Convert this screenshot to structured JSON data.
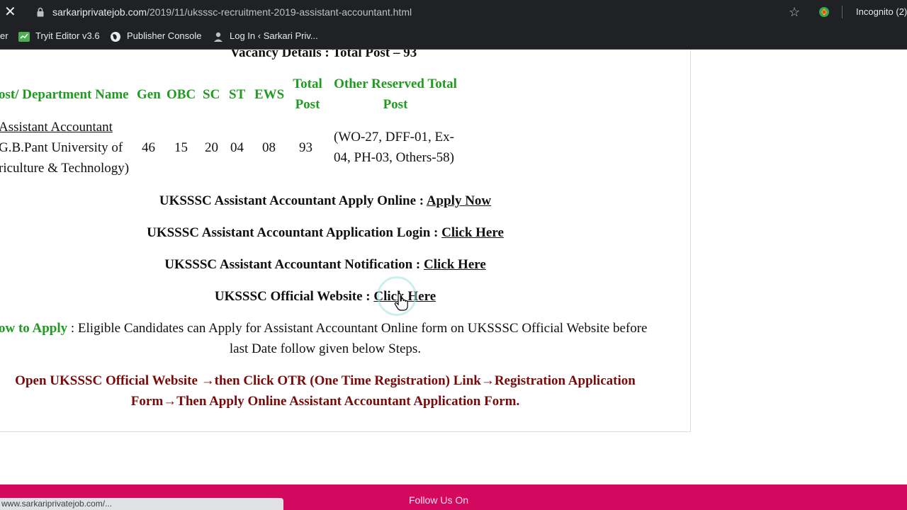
{
  "browser": {
    "url_host": "sarkariprivatejob.com",
    "url_path": "/2019/11/uksssc-recruitment-2019-assistant-accountant.html",
    "incognito_label": "Incognito (2)",
    "icons": [
      "close-icon",
      "lock-icon",
      "star-icon",
      "extension-icon"
    ]
  },
  "bookmarks": [
    {
      "label": "er"
    },
    {
      "label": "Tryit Editor v3.6"
    },
    {
      "label": "Publisher Console"
    },
    {
      "label": "Log In ‹ Sarkari Priv..."
    }
  ],
  "vacancy": {
    "heading": "Vacancy Details : Total Post – 93",
    "headers": {
      "dept": "ost/ Department Name",
      "gen": "Gen",
      "obc": "OBC",
      "sc": "SC",
      "st": "ST",
      "ews": "EWS",
      "total_line1": "Total",
      "total_line2": "Post",
      "other_line1": "Other Reserved Total",
      "other_line2": "Post"
    },
    "row": {
      "dept_line1": "Assistant Accountant",
      "dept_line2": "G.B.Pant University of",
      "dept_line3": "riculture & Technology)",
      "gen": "46",
      "obc": "15",
      "sc": "20",
      "st": "04",
      "ews": "08",
      "total": "93",
      "other_line1": "(WO-27, DFF-01, Ex-",
      "other_line2": "04, PH-03, Others-58)"
    }
  },
  "links": [
    {
      "label": "UKSSSC Assistant Accountant Apply Online : ",
      "link": "Apply Now"
    },
    {
      "label": "UKSSSC Assistant Accountant Application Login : ",
      "link": "Click Here"
    },
    {
      "label": "UKSSSC Assistant Accountant Notification : ",
      "link": "Click Here"
    },
    {
      "label": "UKSSSC Official Website : ",
      "link": "Click Here"
    }
  ],
  "how_to_apply": {
    "label": "ow to Apply",
    "text_line1": " : Eligible Candidates can Apply for Assistant Accountant Online form on UKSSSC Official Website before",
    "text_line2": "last Date follow given below Steps."
  },
  "steps": {
    "line1": "Open UKSSSC Official Website →then Click OTR (One Time Registration) Link→Registration Application",
    "line2": "Form→Then Apply Online Assistant Accountant Application Form."
  },
  "footer": {
    "title": "Follow Us On"
  },
  "status_url": "www.sarkariprivatejob.com/...",
  "colors": {
    "green": "#1f9b1f",
    "dark_red": "#7a0a0a",
    "footer_pink": "#d4085f",
    "chrome": "#202124"
  }
}
